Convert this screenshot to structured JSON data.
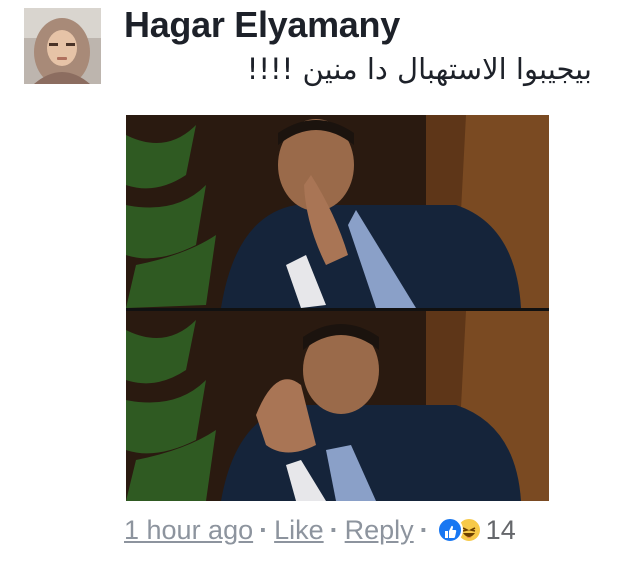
{
  "comment": {
    "author": "Hagar Elyamany",
    "text": "بيجيبوا الاستهبال دا منين !!!!",
    "avatar_icon": "profile-photo-woman-hijab",
    "image_icon": "meme-image-two-panel"
  },
  "meta": {
    "time": "1 hour ago",
    "like_label": "Like",
    "reply_label": "Reply",
    "separator": "·",
    "reaction_icons": [
      "like-reaction-icon",
      "haha-reaction-icon"
    ],
    "reaction_count": "14"
  },
  "colors": {
    "name": "#1d2129",
    "meta": "#8d949e",
    "like_blue": "#1877f2",
    "haha_yellow": "#f7c948"
  }
}
